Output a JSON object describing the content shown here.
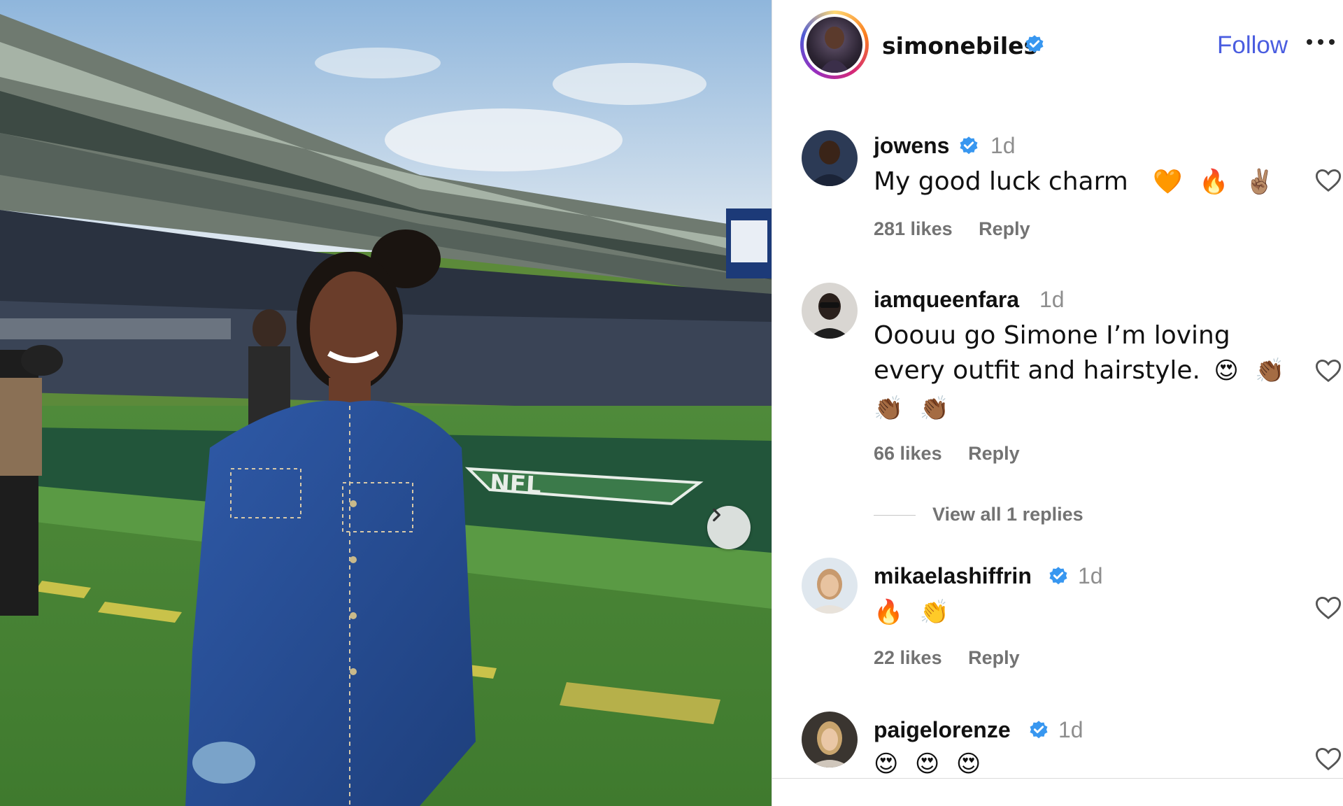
{
  "post": {
    "owner": {
      "username": "simonebiles",
      "verified": true
    },
    "follow_label": "Follow",
    "more_icon": "more-options-icon",
    "carousel_next_icon": "chevron-right-icon",
    "photo_scene_text": "NFL"
  },
  "comments": [
    {
      "username": "jowens",
      "verified": true,
      "time": "1d",
      "text": "My good luck charm",
      "emojis": [
        "🧡",
        "🔥",
        "✌🏽"
      ],
      "likes": "281 likes",
      "reply": "Reply"
    },
    {
      "username": "iamqueenfara",
      "verified": false,
      "time": "1d",
      "text_line1": "Ooouu go Simone I’m loving",
      "text_line2": "every outfit and hairstyle.",
      "emojis_line2": [
        "😍",
        "👏🏾"
      ],
      "emojis_line3": [
        "👏🏾",
        "👏🏾"
      ],
      "likes": "66 likes",
      "reply": "Reply",
      "view_replies": "View all 1 replies"
    },
    {
      "username": "mikaelashiffrin",
      "verified": true,
      "time": "1d",
      "emojis": [
        "🔥",
        "👏"
      ],
      "likes": "22 likes",
      "reply": "Reply"
    },
    {
      "username": "paigelorenze",
      "verified": true,
      "time": "1d",
      "emojis": [
        "😍",
        "😍",
        "😍"
      ]
    }
  ],
  "colors": {
    "follow_blue": "#4a5de0",
    "verified_blue": "#3897f0",
    "muted_text": "#737373"
  }
}
